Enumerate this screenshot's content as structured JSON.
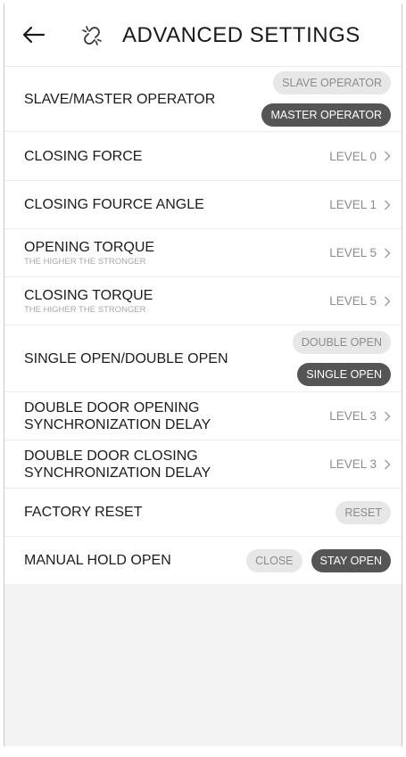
{
  "header": {
    "title": "ADVANCED SETTINGS",
    "back_icon": "back-arrow-icon",
    "link_icon": "broken-link-icon"
  },
  "rows": {
    "slave_master": {
      "label": "SLAVE/MASTER OPERATOR",
      "option_1": "SLAVE OPERATOR",
      "option_2": "MASTER OPERATOR",
      "selected": "MASTER OPERATOR"
    },
    "closing_force": {
      "label": "CLOSING FORCE",
      "value": "LEVEL 0"
    },
    "closing_force_angle": {
      "label": "CLOSING FOURCE ANGLE",
      "value": "LEVEL 1"
    },
    "opening_torque": {
      "label": "OPENING TORQUE",
      "sub": "THE HIGHER THE STRONGER",
      "value": "LEVEL 5"
    },
    "closing_torque": {
      "label": "CLOSING TORQUE",
      "sub": "THE HIGHER THE STRONGER",
      "value": "LEVEL 5"
    },
    "single_double": {
      "label": "SINGLE OPEN/DOUBLE OPEN",
      "option_1": "DOUBLE OPEN",
      "option_2": "SINGLE OPEN",
      "selected": "SINGLE OPEN"
    },
    "opening_delay": {
      "label_1": "DOUBLE DOOR OPENING",
      "label_2": "SYNCHRONIZATION DELAY",
      "value": "LEVEL 3"
    },
    "closing_delay": {
      "label_1": "DOUBLE DOOR CLOSING",
      "label_2": "SYNCHRONIZATION DELAY",
      "value": "LEVEL 3"
    },
    "factory_reset": {
      "label": "FACTORY RESET",
      "button": "RESET"
    },
    "manual_hold": {
      "label": "MANUAL HOLD OPEN",
      "option_1": "CLOSE",
      "option_2": "STAY OPEN",
      "selected": "STAY OPEN"
    }
  },
  "colors": {
    "selected_pill": "#555555",
    "unselected_pill": "#e7e7e7",
    "background": "#f3f3f3"
  },
  "icons": {
    "row_chevron": "chevron-right-icon"
  }
}
